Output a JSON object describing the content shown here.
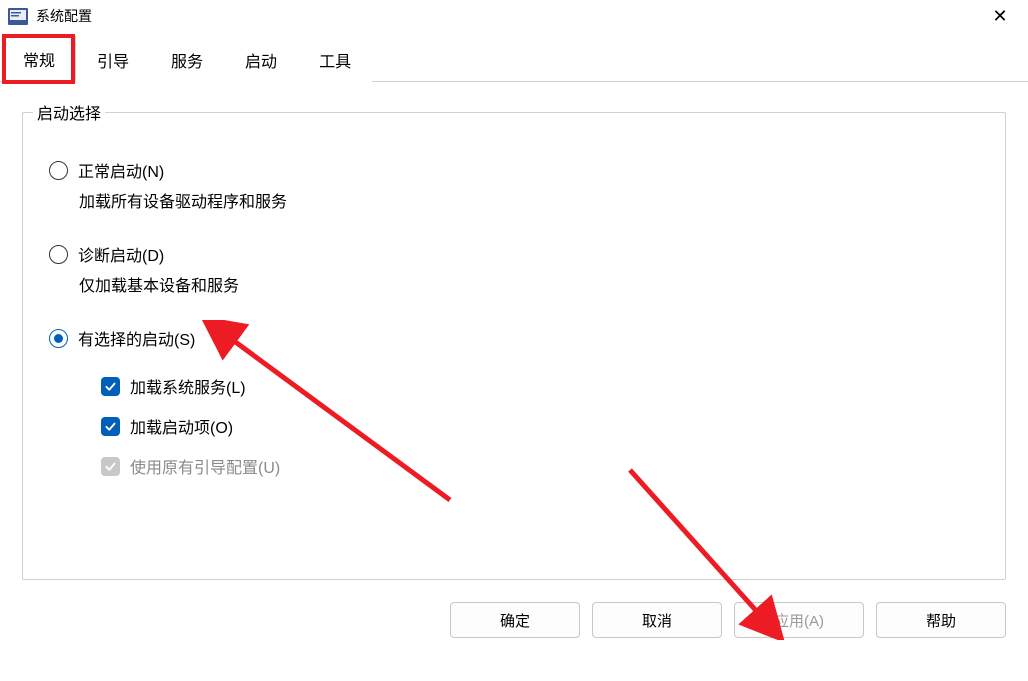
{
  "window": {
    "title": "系统配置",
    "close_label": "✕"
  },
  "tabs": [
    {
      "id": "general",
      "label": "常规",
      "active": true
    },
    {
      "id": "boot",
      "label": "引导",
      "active": false
    },
    {
      "id": "services",
      "label": "服务",
      "active": false
    },
    {
      "id": "startup",
      "label": "启动",
      "active": false
    },
    {
      "id": "tools",
      "label": "工具",
      "active": false
    }
  ],
  "group": {
    "legend": "启动选择",
    "options": {
      "normal": {
        "label": "正常启动(N)",
        "desc": "加载所有设备驱动程序和服务",
        "checked": false
      },
      "diagnostic": {
        "label": "诊断启动(D)",
        "desc": "仅加载基本设备和服务",
        "checked": false
      },
      "selective": {
        "label": "有选择的启动(S)",
        "checked": true,
        "children": {
          "load_services": {
            "label": "加载系统服务(L)",
            "checked": true,
            "disabled": false
          },
          "load_startup": {
            "label": "加载启动项(O)",
            "checked": true,
            "disabled": false
          },
          "original_boot": {
            "label": "使用原有引导配置(U)",
            "checked": true,
            "disabled": true
          }
        }
      }
    }
  },
  "buttons": {
    "ok": "确定",
    "cancel": "取消",
    "apply": "应用(A)",
    "help": "帮助"
  },
  "annotations": {
    "highlight_tab": "general",
    "arrows": [
      "to-selective-radio",
      "to-apply-button"
    ]
  }
}
